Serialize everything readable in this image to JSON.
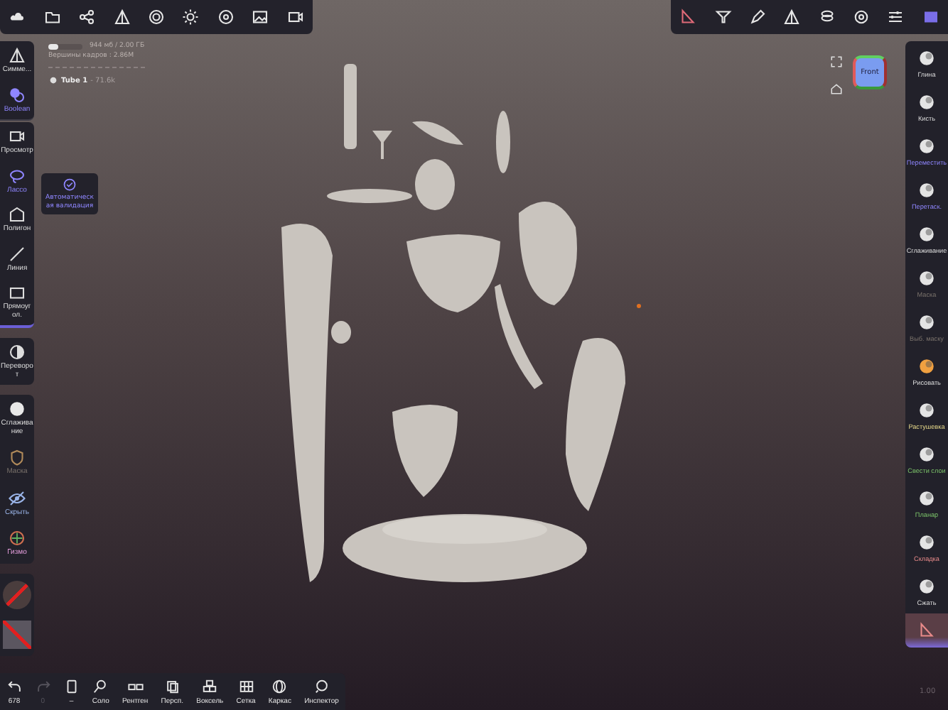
{
  "info": {
    "memory": {
      "level": 0.3,
      "reading": "944 мб / 2.00 ГБ"
    },
    "vertices": "Вершины кадров : 2.86M",
    "object": {
      "name": "Tube 1",
      "count": "- 71.6k"
    }
  },
  "left_panels": [
    {
      "tools": [
        {
          "label": "Симме...",
          "kind": "plain"
        },
        {
          "label": "Boolean",
          "kind": "accent"
        }
      ]
    },
    {
      "tools": [
        {
          "label": "Просмотр",
          "kind": "plain"
        },
        {
          "label": "Лассо",
          "kind": "accent"
        },
        {
          "label": "Полигон",
          "kind": "plain"
        },
        {
          "label": "Линия",
          "kind": "plain"
        },
        {
          "label": "Прямоуг ол.",
          "kind": "plain"
        }
      ]
    },
    {
      "tools": [
        {
          "label": "Переворот",
          "kind": "plain"
        }
      ]
    },
    {
      "tools": [
        {
          "label": "Сглаживание",
          "kind": "plain"
        },
        {
          "label": "Маска",
          "kind": "muted"
        },
        {
          "label": "Скрыть",
          "kind": "hide"
        },
        {
          "label": "Гизмо",
          "kind": "gizmo"
        }
      ]
    }
  ],
  "tooltip": {
    "label": "Автоматическая валидация"
  },
  "gizmo": {
    "label": "Front"
  },
  "right_tools": [
    {
      "label": "Глина",
      "kind": "plain",
      "selected": false
    },
    {
      "label": "Кисть",
      "kind": "plain",
      "selected": false
    },
    {
      "label": "Переместить",
      "kind": "accent",
      "selected": false
    },
    {
      "label": "Перетаск.",
      "kind": "accent",
      "selected": false
    },
    {
      "label": "Сглаживание",
      "kind": "plain",
      "selected": false
    },
    {
      "label": "Маска",
      "kind": "muted",
      "selected": false
    },
    {
      "label": "Выб. маску",
      "kind": "muted",
      "selected": false
    },
    {
      "label": "Рисовать",
      "kind": "plain",
      "selected": false
    },
    {
      "label": "Растушевка",
      "kind": "feather",
      "selected": false
    },
    {
      "label": "Свести слои",
      "kind": "flatten",
      "selected": false
    },
    {
      "label": "Планар",
      "kind": "flatten",
      "selected": false
    },
    {
      "label": "Складка",
      "kind": "crease",
      "selected": false
    },
    {
      "label": "Сжать",
      "kind": "plain",
      "selected": false
    },
    {
      "kind": "crease",
      "selected": true
    }
  ],
  "bottom_bar": [
    {
      "label": "678",
      "disabled": false
    },
    {
      "label": "0",
      "disabled": true
    },
    {
      "label": "–",
      "disabled": false
    },
    {
      "label": "Соло",
      "disabled": false
    },
    {
      "label": "Рентген",
      "disabled": false
    },
    {
      "label": "Персп.",
      "disabled": false
    },
    {
      "label": "Воксель",
      "disabled": false
    },
    {
      "label": "Сетка",
      "disabled": false
    },
    {
      "label": "Каркас",
      "disabled": false
    },
    {
      "label": "Инспектор",
      "disabled": false
    }
  ],
  "zoom_reading": "1.00"
}
